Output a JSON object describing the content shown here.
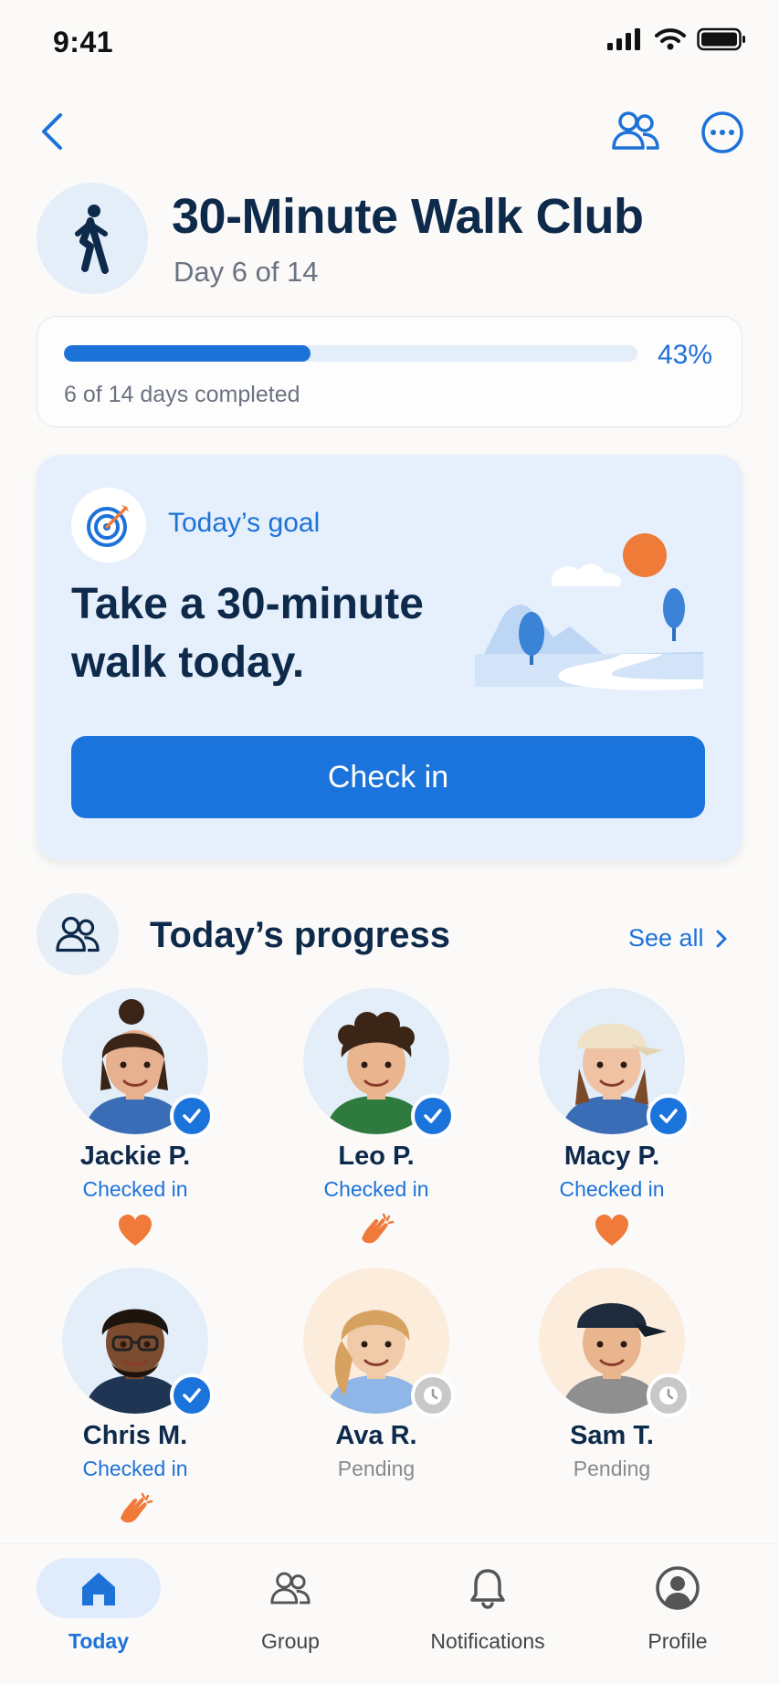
{
  "status_bar": {
    "time": "9:41"
  },
  "header": {
    "title": "30-Minute Walk Club",
    "subtitle": "Day 6 of 14",
    "icons": [
      "back-chevron-icon",
      "group-icon",
      "more-icon",
      "walking-person-icon"
    ]
  },
  "progress": {
    "percent_label": "43%",
    "fraction": 0.43,
    "caption": "6 of 14 days completed"
  },
  "goal": {
    "label": "Today’s goal",
    "text": "Take a 30-minute walk today.",
    "button_label": "Check in"
  },
  "todays_progress": {
    "title": "Today’s progress",
    "see_all": "See all",
    "members": [
      {
        "name": "Jackie P.",
        "status": "Checked in",
        "state": "ok",
        "reaction": "heart-icon"
      },
      {
        "name": "Leo P.",
        "status": "Checked in",
        "state": "ok",
        "reaction": "clap-icon"
      },
      {
        "name": "Macy P.",
        "status": "Checked in",
        "state": "ok",
        "reaction": "heart-icon"
      },
      {
        "name": "Chris M.",
        "status": "Checked in",
        "state": "ok",
        "reaction": "clap-icon"
      },
      {
        "name": "Ava R.",
        "status": "Pending",
        "state": "pending",
        "reaction": ""
      },
      {
        "name": "Sam T.",
        "status": "Pending",
        "state": "pending",
        "reaction": ""
      }
    ]
  },
  "bottom_nav": {
    "tabs": [
      {
        "label": "Today",
        "icon": "home-icon",
        "active": true
      },
      {
        "label": "Group",
        "icon": "group-icon",
        "active": false
      },
      {
        "label": "Notifications",
        "icon": "bell-icon",
        "active": false
      },
      {
        "label": "Profile",
        "icon": "profile-icon",
        "active": false
      }
    ]
  },
  "colors": {
    "accent": "#1d72d8",
    "reaction": "#ef7a3a",
    "title": "#0e2a4b"
  }
}
